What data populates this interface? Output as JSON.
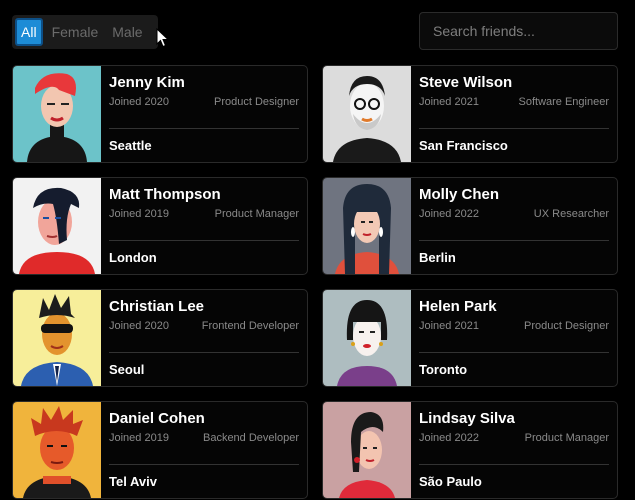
{
  "filters": {
    "all": "All",
    "female": "Female",
    "male": "Male",
    "active": "All"
  },
  "search": {
    "placeholder": "Search friends..."
  },
  "friends": [
    {
      "name": "Jenny Kim",
      "joined": "Joined 2020",
      "role": "Product Designer",
      "city": "Seattle",
      "bg": "#6cc3c9"
    },
    {
      "name": "Steve Wilson",
      "joined": "Joined 2021",
      "role": "Software Engineer",
      "city": "San Francisco",
      "bg": "#dcdcdc"
    },
    {
      "name": "Matt Thompson",
      "joined": "Joined 2019",
      "role": "Product Manager",
      "city": "London",
      "bg": "#f2f2f2"
    },
    {
      "name": "Molly Chen",
      "joined": "Joined 2022",
      "role": "UX Researcher",
      "city": "Berlin",
      "bg": "#6f7480"
    },
    {
      "name": "Christian Lee",
      "joined": "Joined 2020",
      "role": "Frontend Developer",
      "city": "Seoul",
      "bg": "#f7ee9a"
    },
    {
      "name": "Helen Park",
      "joined": "Joined 2021",
      "role": "Product Designer",
      "city": "Toronto",
      "bg": "#aebdc0"
    },
    {
      "name": "Daniel Cohen",
      "joined": "Joined 2019",
      "role": "Backend Developer",
      "city": "Tel Aviv",
      "bg": "#f0b43c"
    },
    {
      "name": "Lindsay Silva",
      "joined": "Joined 2022",
      "role": "Product Manager",
      "city": "São Paulo",
      "bg": "#c9a1a2"
    }
  ]
}
